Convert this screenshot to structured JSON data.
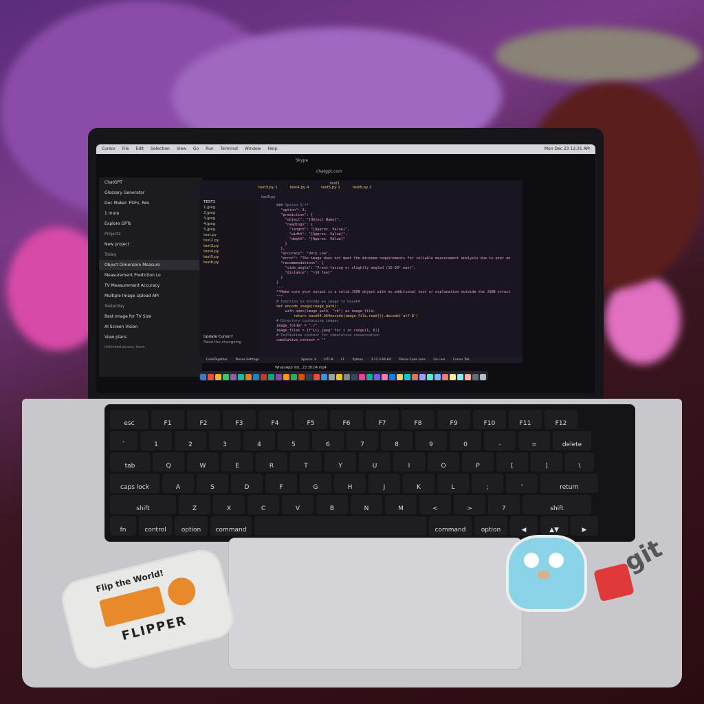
{
  "menubar": {
    "items": [
      "Cursor",
      "File",
      "Edit",
      "Selection",
      "View",
      "Go",
      "Run",
      "Terminal",
      "Window",
      "Help"
    ],
    "datetime": "Mon Dec 23  12:31 AM",
    "skype_title": "Skype",
    "url": "chatgpt.com"
  },
  "chatgpt_sidebar": {
    "items": [
      "ChatGPT",
      "Glossary Generator",
      "Doc Maker: PDFs, Res",
      "1 more",
      "Explore GPTs"
    ],
    "projects_heading": "Projects",
    "new_project": "New project",
    "today_heading": "Today",
    "today_items": [
      "Object Dimension Measure",
      "Measurement Prediction Lo",
      "TV Measurement Accuracy",
      "Multiple Image Upload API"
    ],
    "yesterday_heading": "Yesterday",
    "yesterday_items": [
      "Best Image for TV Size",
      "AI Screen Vision"
    ],
    "plans": "View plans",
    "plans_sub": "Unlimited access, team"
  },
  "editor": {
    "search": "test1",
    "tabs": [
      "test3.py 1",
      "test4.py 4",
      "test5.py 1",
      "test6.py 2"
    ],
    "breadcrumb": "test5.py",
    "explorer_title": "TEST1",
    "files": [
      "1.jpeg",
      "2.jpeg",
      "3.jpeg",
      "4.jpeg",
      "5.jpeg",
      "test.py",
      "test2.py",
      "test3.py",
      "test4.py",
      "test5.py",
      "test6.py"
    ],
    "code_lines": [
      "### Option 3:**",
      "",
      "  \"option\": 3,",
      "  \"prediction\": {",
      "    \"object\": \"[Object Name]\",",
      "    \"readings\": {",
      "      \"length\": \"[Approx. Value]\",",
      "      \"width\": \"[Approx. Value]\",",
      "      \"depth\": \"[Approx. Value]\"",
      "    }",
      "  },",
      "  \"accuracy\": \"Very Low\",",
      "  \"error\": \"The image does not meet the minimum requirements for reliable measurement analysis due to poor an",
      "  \"recommendations\": {",
      "    \"side_angle\": \"Front-facing or slightly angled (15-30° max)\",",
      "    \"distance\": \"~10 feet\"",
      "  }",
      "}",
      "",
      "---",
      "",
      "**Make sure your output is a valid JSON object with no additional text or explanation outside the JSON struct",
      "\"\"\"",
      "",
      "# Function to encode an image to base64",
      "def encode_image(image_path):",
      "    with open(image_path, \"rb\") as image_file:",
      "        return base64.b64encode(image_file.read()).decode('utf-8')",
      "",
      "# Directory containing images",
      "image_folder = \"./\"",
      "image_files = [f\"{i}.jpeg\" for i in range(1, 6)]",
      "",
      "# Initialize context for cumulative conversation",
      "cumulative_context = \"\""
    ],
    "update_notice": "Update Cursor?",
    "update_sub": "Read the changelog",
    "status": [
      "CodeTogether",
      "Pieces Settings",
      "Spaces: 4",
      "UTF-8",
      "LF",
      "Python",
      "3.12.3 64-bit",
      "Pieces Code Lens",
      "Go Live",
      "Cursor Tab"
    ],
    "download_file": "WhatsApp Vid...23.30.04.mp4"
  },
  "keyboard": {
    "rows": [
      [
        "esc",
        "F1",
        "F2",
        "F3",
        "F4",
        "F5",
        "F6",
        "F7",
        "F8",
        "F9",
        "F10",
        "F11",
        "F12"
      ],
      [
        "`",
        "1",
        "2",
        "3",
        "4",
        "5",
        "6",
        "7",
        "8",
        "9",
        "0",
        "-",
        "=",
        "delete"
      ],
      [
        "tab",
        "Q",
        "W",
        "E",
        "R",
        "T",
        "Y",
        "U",
        "I",
        "O",
        "P",
        "[",
        "]",
        "\\"
      ],
      [
        "caps lock",
        "A",
        "S",
        "D",
        "F",
        "G",
        "H",
        "J",
        "K",
        "L",
        ";",
        "'",
        "return"
      ],
      [
        "shift",
        "Z",
        "X",
        "C",
        "V",
        "B",
        "N",
        "M",
        "<",
        ">",
        "?",
        "shift"
      ],
      [
        "fn",
        "control",
        "option",
        "command",
        "",
        "command",
        "option",
        "◀",
        "▲▼",
        "▶"
      ]
    ]
  },
  "stickers": {
    "flipper_top": "Flip the World!",
    "flipper_brand": "FLIPPER",
    "git": "git"
  }
}
